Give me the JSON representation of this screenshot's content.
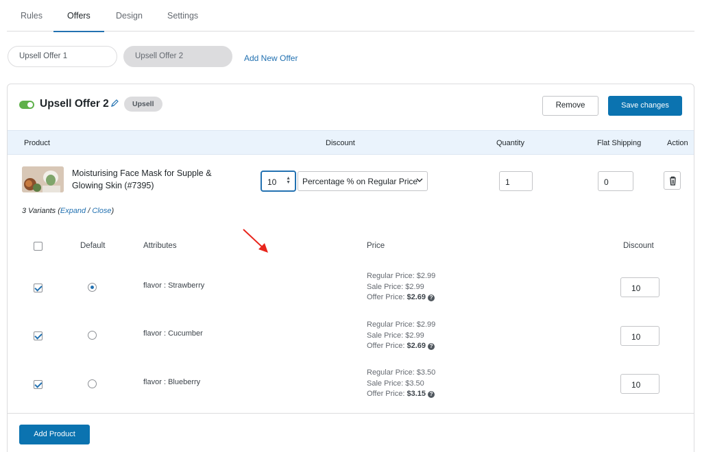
{
  "tabs": [
    {
      "label": "Rules"
    },
    {
      "label": "Offers",
      "active": true
    },
    {
      "label": "Design"
    },
    {
      "label": "Settings"
    }
  ],
  "offers": [
    {
      "label": "Upsell Offer 1"
    },
    {
      "label": "Upsell Offer 2",
      "selected": true
    }
  ],
  "add_offer_label": "Add New Offer",
  "card": {
    "enabled": true,
    "title": "Upsell Offer 2",
    "type_badge": "Upsell",
    "remove_label": "Remove",
    "save_label": "Save changes"
  },
  "table": {
    "headers": {
      "product": "Product",
      "discount": "Discount",
      "quantity": "Quantity",
      "flat_shipping": "Flat Shipping",
      "action": "Action"
    },
    "product": {
      "name": "Moisturising Face Mask for Supple & Glowing Skin (#7395)",
      "discount_value": "10",
      "discount_type": "Percentage % on Regular Price",
      "quantity": "1",
      "flat_shipping": "0"
    }
  },
  "variants_summary": {
    "count_text": "3 Variants",
    "open_paren": "(",
    "expand": "Expand",
    "sep": "/",
    "close": "Close",
    "close_paren": ")"
  },
  "variant_headers": {
    "default": "Default",
    "attributes": "Attributes",
    "price": "Price",
    "discount": "Discount"
  },
  "variants": [
    {
      "checked": true,
      "default": true,
      "attribute": "flavor : Strawberry",
      "regular": "Regular Price: $2.99",
      "sale": "Sale Price: $2.99",
      "offer_label": "Offer Price:",
      "offer_value": "$2.69",
      "discount": "10"
    },
    {
      "checked": true,
      "default": false,
      "attribute": "flavor : Cucumber",
      "regular": "Regular Price: $2.99",
      "sale": "Sale Price: $2.99",
      "offer_label": "Offer Price:",
      "offer_value": "$2.69",
      "discount": "10"
    },
    {
      "checked": true,
      "default": false,
      "attribute": "flavor : Blueberry",
      "regular": "Regular Price: $3.50",
      "sale": "Sale Price: $3.50",
      "offer_label": "Offer Price:",
      "offer_value": "$3.15",
      "discount": "10"
    }
  ],
  "add_product_label": "Add Product",
  "colors": {
    "accent": "#0b73b0",
    "link": "#2271b1",
    "toggle_on": "#5fb14a",
    "annotation_arrow": "#e8251c"
  }
}
